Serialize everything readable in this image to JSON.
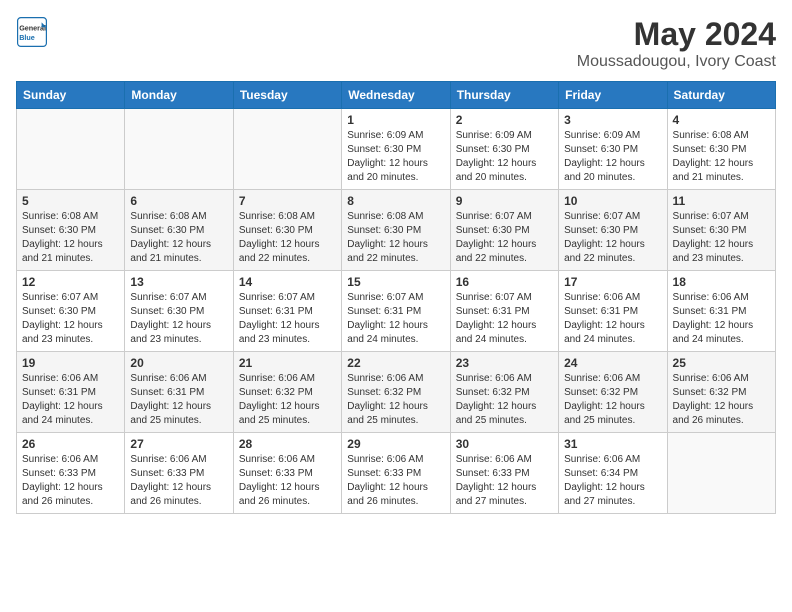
{
  "header": {
    "logo_general": "General",
    "logo_blue": "Blue",
    "month_year": "May 2024",
    "location": "Moussadougou, Ivory Coast"
  },
  "weekdays": [
    "Sunday",
    "Monday",
    "Tuesday",
    "Wednesday",
    "Thursday",
    "Friday",
    "Saturday"
  ],
  "weeks": [
    [
      {
        "day": "",
        "info": ""
      },
      {
        "day": "",
        "info": ""
      },
      {
        "day": "",
        "info": ""
      },
      {
        "day": "1",
        "info": "Sunrise: 6:09 AM\nSunset: 6:30 PM\nDaylight: 12 hours\nand 20 minutes."
      },
      {
        "day": "2",
        "info": "Sunrise: 6:09 AM\nSunset: 6:30 PM\nDaylight: 12 hours\nand 20 minutes."
      },
      {
        "day": "3",
        "info": "Sunrise: 6:09 AM\nSunset: 6:30 PM\nDaylight: 12 hours\nand 20 minutes."
      },
      {
        "day": "4",
        "info": "Sunrise: 6:08 AM\nSunset: 6:30 PM\nDaylight: 12 hours\nand 21 minutes."
      }
    ],
    [
      {
        "day": "5",
        "info": "Sunrise: 6:08 AM\nSunset: 6:30 PM\nDaylight: 12 hours\nand 21 minutes."
      },
      {
        "day": "6",
        "info": "Sunrise: 6:08 AM\nSunset: 6:30 PM\nDaylight: 12 hours\nand 21 minutes."
      },
      {
        "day": "7",
        "info": "Sunrise: 6:08 AM\nSunset: 6:30 PM\nDaylight: 12 hours\nand 22 minutes."
      },
      {
        "day": "8",
        "info": "Sunrise: 6:08 AM\nSunset: 6:30 PM\nDaylight: 12 hours\nand 22 minutes."
      },
      {
        "day": "9",
        "info": "Sunrise: 6:07 AM\nSunset: 6:30 PM\nDaylight: 12 hours\nand 22 minutes."
      },
      {
        "day": "10",
        "info": "Sunrise: 6:07 AM\nSunset: 6:30 PM\nDaylight: 12 hours\nand 22 minutes."
      },
      {
        "day": "11",
        "info": "Sunrise: 6:07 AM\nSunset: 6:30 PM\nDaylight: 12 hours\nand 23 minutes."
      }
    ],
    [
      {
        "day": "12",
        "info": "Sunrise: 6:07 AM\nSunset: 6:30 PM\nDaylight: 12 hours\nand 23 minutes."
      },
      {
        "day": "13",
        "info": "Sunrise: 6:07 AM\nSunset: 6:30 PM\nDaylight: 12 hours\nand 23 minutes."
      },
      {
        "day": "14",
        "info": "Sunrise: 6:07 AM\nSunset: 6:31 PM\nDaylight: 12 hours\nand 23 minutes."
      },
      {
        "day": "15",
        "info": "Sunrise: 6:07 AM\nSunset: 6:31 PM\nDaylight: 12 hours\nand 24 minutes."
      },
      {
        "day": "16",
        "info": "Sunrise: 6:07 AM\nSunset: 6:31 PM\nDaylight: 12 hours\nand 24 minutes."
      },
      {
        "day": "17",
        "info": "Sunrise: 6:06 AM\nSunset: 6:31 PM\nDaylight: 12 hours\nand 24 minutes."
      },
      {
        "day": "18",
        "info": "Sunrise: 6:06 AM\nSunset: 6:31 PM\nDaylight: 12 hours\nand 24 minutes."
      }
    ],
    [
      {
        "day": "19",
        "info": "Sunrise: 6:06 AM\nSunset: 6:31 PM\nDaylight: 12 hours\nand 24 minutes."
      },
      {
        "day": "20",
        "info": "Sunrise: 6:06 AM\nSunset: 6:31 PM\nDaylight: 12 hours\nand 25 minutes."
      },
      {
        "day": "21",
        "info": "Sunrise: 6:06 AM\nSunset: 6:32 PM\nDaylight: 12 hours\nand 25 minutes."
      },
      {
        "day": "22",
        "info": "Sunrise: 6:06 AM\nSunset: 6:32 PM\nDaylight: 12 hours\nand 25 minutes."
      },
      {
        "day": "23",
        "info": "Sunrise: 6:06 AM\nSunset: 6:32 PM\nDaylight: 12 hours\nand 25 minutes."
      },
      {
        "day": "24",
        "info": "Sunrise: 6:06 AM\nSunset: 6:32 PM\nDaylight: 12 hours\nand 25 minutes."
      },
      {
        "day": "25",
        "info": "Sunrise: 6:06 AM\nSunset: 6:32 PM\nDaylight: 12 hours\nand 26 minutes."
      }
    ],
    [
      {
        "day": "26",
        "info": "Sunrise: 6:06 AM\nSunset: 6:33 PM\nDaylight: 12 hours\nand 26 minutes."
      },
      {
        "day": "27",
        "info": "Sunrise: 6:06 AM\nSunset: 6:33 PM\nDaylight: 12 hours\nand 26 minutes."
      },
      {
        "day": "28",
        "info": "Sunrise: 6:06 AM\nSunset: 6:33 PM\nDaylight: 12 hours\nand 26 minutes."
      },
      {
        "day": "29",
        "info": "Sunrise: 6:06 AM\nSunset: 6:33 PM\nDaylight: 12 hours\nand 26 minutes."
      },
      {
        "day": "30",
        "info": "Sunrise: 6:06 AM\nSunset: 6:33 PM\nDaylight: 12 hours\nand 27 minutes."
      },
      {
        "day": "31",
        "info": "Sunrise: 6:06 AM\nSunset: 6:34 PM\nDaylight: 12 hours\nand 27 minutes."
      },
      {
        "day": "",
        "info": ""
      }
    ]
  ]
}
